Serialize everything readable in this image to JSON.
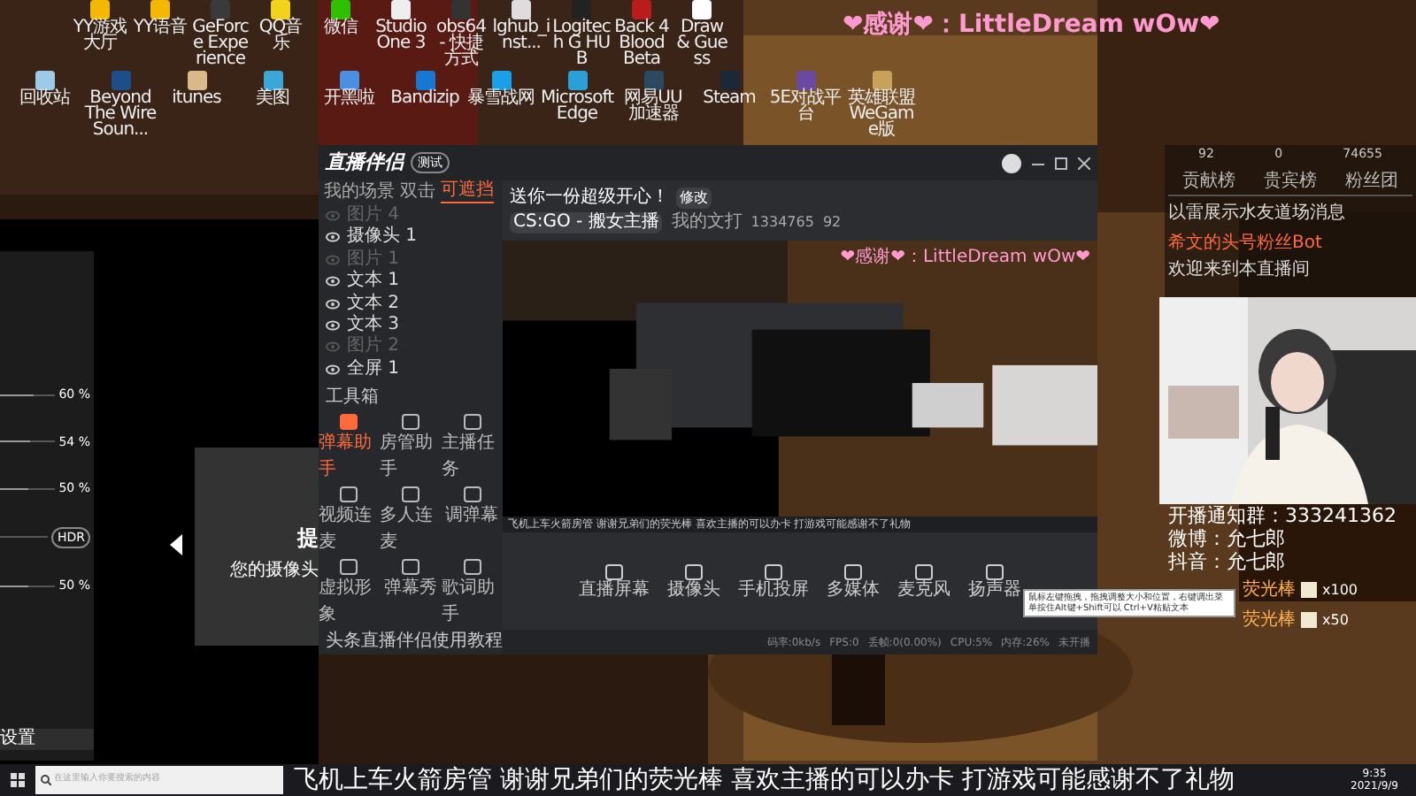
{
  "desktop": {
    "icons_row_1": [
      "YY游戏大厅",
      "YY语音",
      "GeForce Experience",
      "QQ音乐",
      "微信",
      "Studio One 3",
      "obs64 - 快捷方式",
      "lghub_inst...",
      "Logitech G HUB",
      "Back 4 Blood Beta",
      "Draw & Guess"
    ],
    "icons_row_2": [
      "回收站",
      "Beyond The Wire Soun...",
      "itunes",
      "美图",
      "开黑啦",
      "Bandizip",
      "暴雪战网",
      "Microsoft Edge",
      "网易UU加速器",
      "Steam",
      "5E对战平台",
      "英雄联盟 WeGame版"
    ],
    "overlay_banner": "❤感谢❤：LittleDream wOw❤"
  },
  "left_panel": {
    "sliders": [
      {
        "reading": "60 %",
        "level": 0.6
      },
      {
        "reading": "54 %",
        "level": 0.54
      },
      {
        "reading": "50 %",
        "level": 0.5
      },
      {
        "reading": "HDR",
        "kind": "toggle"
      },
      {
        "reading": "50 %",
        "level": 0.5
      }
    ],
    "footer": "设置",
    "card_title": "提",
    "card_text": "您的摄像头"
  },
  "app": {
    "title": "直播伴侣",
    "badge": "测试",
    "tabs": [
      {
        "label": "我的场景",
        "selected": false
      },
      {
        "label": "双击",
        "selected": false
      },
      {
        "label": "可遮挡",
        "selected": true
      }
    ],
    "sources": [
      {
        "label": "图片 4",
        "visible": false
      },
      {
        "label": "摄像头 1",
        "visible": true
      },
      {
        "label": "图片 1",
        "visible": false
      },
      {
        "label": "文本 1",
        "visible": true
      },
      {
        "label": "文本 2",
        "visible": true
      },
      {
        "label": "文本 3",
        "visible": true
      },
      {
        "label": "图片 2",
        "visible": false
      },
      {
        "label": "全屏 1",
        "visible": true
      }
    ],
    "toolbox_title": "工具箱",
    "tools": [
      {
        "label": "弹幕助手",
        "selected": true
      },
      {
        "label": "房管助手",
        "selected": false
      },
      {
        "label": "主播任务",
        "selected": false
      },
      {
        "label": "视频连麦",
        "selected": false
      },
      {
        "label": "多人连麦",
        "selected": false
      },
      {
        "label": "调弹幕",
        "selected": false
      },
      {
        "label": "虚拟形象",
        "selected": false
      },
      {
        "label": "弹幕秀",
        "selected": false
      },
      {
        "label": "歌词助手",
        "selected": false
      }
    ],
    "tutorial": "头条直播伴侣使用教程",
    "stream_title": "送你一份超级开心！",
    "edit_button": "修改",
    "category": "CS:GO - 搬女主播",
    "channel": "我的文打",
    "room_id": "1334765",
    "viewers": "92",
    "preview_banner": "❤感谢❤：LittleDream wOw❤",
    "ticker": "飞机上车火箭房管 谢谢兄弟们的荧光棒 喜欢主播的可以办卡 打游戏可能感谢不了礼物",
    "controls": [
      "直播屏幕",
      "摄像头",
      "手机投屏",
      "多媒体",
      "麦克风",
      "扬声器"
    ],
    "status": [
      "码率:0kb/s",
      "FPS:0",
      "丢帧:0(0.00%)",
      "CPU:5%",
      "内存:26%",
      "未开播"
    ]
  },
  "chat_panel": {
    "stats": [
      "92",
      "0",
      "74655"
    ],
    "tabs": [
      {
        "label": "贡献榜",
        "selected": false
      },
      {
        "label": "贵宾榜",
        "selected": false
      },
      {
        "label": "粉丝团",
        "selected": false
      }
    ],
    "notice": "以雷展示水友道场消息",
    "user": "希文的头号粉丝Bot",
    "welcome": "欢迎来到本直播间"
  },
  "stream_overlay": {
    "lines": [
      "开播通知群：333241362",
      "微博：允七郎",
      "抖音：允七郎"
    ],
    "gifts": [
      {
        "name": "荧光棒",
        "count": "x100"
      },
      {
        "name": "荧光棒",
        "count": "x50"
      }
    ]
  },
  "tooltip": "鼠标左键拖拽，拖拽调整大小和位置，右键调出菜单按住Alt键+Shift可以 Ctrl+V粘贴文本",
  "ticker": "飞机上车火箭房管 谢谢兄弟们的荧光棒 喜欢主播的可以办卡 打游戏可能感谢不了礼物",
  "taskbar": {
    "search_placeholder": "在这里输入你要搜索的内容",
    "time": "9:35",
    "date": "2021/9/9"
  }
}
